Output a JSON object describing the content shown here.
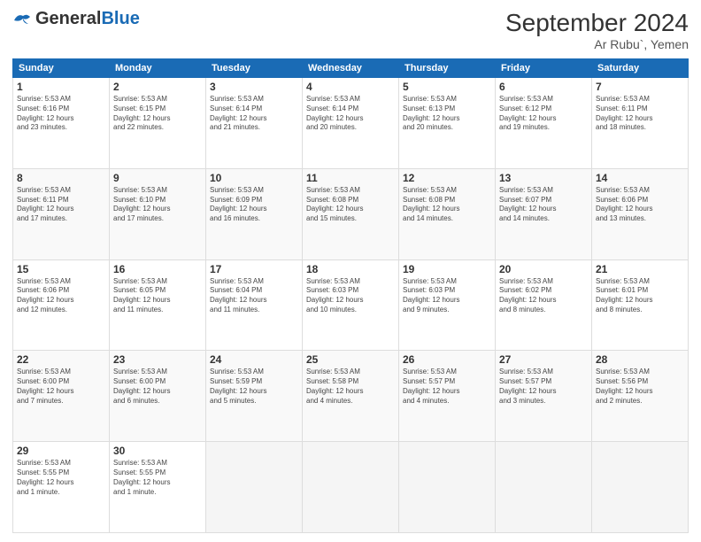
{
  "header": {
    "logo_general": "General",
    "logo_blue": "Blue",
    "logo_sub": "",
    "month_title": "September 2024",
    "location": "Ar Rubu`, Yemen"
  },
  "days_of_week": [
    "Sunday",
    "Monday",
    "Tuesday",
    "Wednesday",
    "Thursday",
    "Friday",
    "Saturday"
  ],
  "weeks": [
    [
      {
        "day": "1",
        "lines": [
          "Sunrise: 5:53 AM",
          "Sunset: 6:16 PM",
          "Daylight: 12 hours",
          "and 23 minutes."
        ]
      },
      {
        "day": "2",
        "lines": [
          "Sunrise: 5:53 AM",
          "Sunset: 6:15 PM",
          "Daylight: 12 hours",
          "and 22 minutes."
        ]
      },
      {
        "day": "3",
        "lines": [
          "Sunrise: 5:53 AM",
          "Sunset: 6:14 PM",
          "Daylight: 12 hours",
          "and 21 minutes."
        ]
      },
      {
        "day": "4",
        "lines": [
          "Sunrise: 5:53 AM",
          "Sunset: 6:14 PM",
          "Daylight: 12 hours",
          "and 20 minutes."
        ]
      },
      {
        "day": "5",
        "lines": [
          "Sunrise: 5:53 AM",
          "Sunset: 6:13 PM",
          "Daylight: 12 hours",
          "and 20 minutes."
        ]
      },
      {
        "day": "6",
        "lines": [
          "Sunrise: 5:53 AM",
          "Sunset: 6:12 PM",
          "Daylight: 12 hours",
          "and 19 minutes."
        ]
      },
      {
        "day": "7",
        "lines": [
          "Sunrise: 5:53 AM",
          "Sunset: 6:11 PM",
          "Daylight: 12 hours",
          "and 18 minutes."
        ]
      }
    ],
    [
      {
        "day": "8",
        "lines": [
          "Sunrise: 5:53 AM",
          "Sunset: 6:11 PM",
          "Daylight: 12 hours",
          "and 17 minutes."
        ]
      },
      {
        "day": "9",
        "lines": [
          "Sunrise: 5:53 AM",
          "Sunset: 6:10 PM",
          "Daylight: 12 hours",
          "and 17 minutes."
        ]
      },
      {
        "day": "10",
        "lines": [
          "Sunrise: 5:53 AM",
          "Sunset: 6:09 PM",
          "Daylight: 12 hours",
          "and 16 minutes."
        ]
      },
      {
        "day": "11",
        "lines": [
          "Sunrise: 5:53 AM",
          "Sunset: 6:08 PM",
          "Daylight: 12 hours",
          "and 15 minutes."
        ]
      },
      {
        "day": "12",
        "lines": [
          "Sunrise: 5:53 AM",
          "Sunset: 6:08 PM",
          "Daylight: 12 hours",
          "and 14 minutes."
        ]
      },
      {
        "day": "13",
        "lines": [
          "Sunrise: 5:53 AM",
          "Sunset: 6:07 PM",
          "Daylight: 12 hours",
          "and 14 minutes."
        ]
      },
      {
        "day": "14",
        "lines": [
          "Sunrise: 5:53 AM",
          "Sunset: 6:06 PM",
          "Daylight: 12 hours",
          "and 13 minutes."
        ]
      }
    ],
    [
      {
        "day": "15",
        "lines": [
          "Sunrise: 5:53 AM",
          "Sunset: 6:06 PM",
          "Daylight: 12 hours",
          "and 12 minutes."
        ]
      },
      {
        "day": "16",
        "lines": [
          "Sunrise: 5:53 AM",
          "Sunset: 6:05 PM",
          "Daylight: 12 hours",
          "and 11 minutes."
        ]
      },
      {
        "day": "17",
        "lines": [
          "Sunrise: 5:53 AM",
          "Sunset: 6:04 PM",
          "Daylight: 12 hours",
          "and 11 minutes."
        ]
      },
      {
        "day": "18",
        "lines": [
          "Sunrise: 5:53 AM",
          "Sunset: 6:03 PM",
          "Daylight: 12 hours",
          "and 10 minutes."
        ]
      },
      {
        "day": "19",
        "lines": [
          "Sunrise: 5:53 AM",
          "Sunset: 6:03 PM",
          "Daylight: 12 hours",
          "and 9 minutes."
        ]
      },
      {
        "day": "20",
        "lines": [
          "Sunrise: 5:53 AM",
          "Sunset: 6:02 PM",
          "Daylight: 12 hours",
          "and 8 minutes."
        ]
      },
      {
        "day": "21",
        "lines": [
          "Sunrise: 5:53 AM",
          "Sunset: 6:01 PM",
          "Daylight: 12 hours",
          "and 8 minutes."
        ]
      }
    ],
    [
      {
        "day": "22",
        "lines": [
          "Sunrise: 5:53 AM",
          "Sunset: 6:00 PM",
          "Daylight: 12 hours",
          "and 7 minutes."
        ]
      },
      {
        "day": "23",
        "lines": [
          "Sunrise: 5:53 AM",
          "Sunset: 6:00 PM",
          "Daylight: 12 hours",
          "and 6 minutes."
        ]
      },
      {
        "day": "24",
        "lines": [
          "Sunrise: 5:53 AM",
          "Sunset: 5:59 PM",
          "Daylight: 12 hours",
          "and 5 minutes."
        ]
      },
      {
        "day": "25",
        "lines": [
          "Sunrise: 5:53 AM",
          "Sunset: 5:58 PM",
          "Daylight: 12 hours",
          "and 4 minutes."
        ]
      },
      {
        "day": "26",
        "lines": [
          "Sunrise: 5:53 AM",
          "Sunset: 5:57 PM",
          "Daylight: 12 hours",
          "and 4 minutes."
        ]
      },
      {
        "day": "27",
        "lines": [
          "Sunrise: 5:53 AM",
          "Sunset: 5:57 PM",
          "Daylight: 12 hours",
          "and 3 minutes."
        ]
      },
      {
        "day": "28",
        "lines": [
          "Sunrise: 5:53 AM",
          "Sunset: 5:56 PM",
          "Daylight: 12 hours",
          "and 2 minutes."
        ]
      }
    ],
    [
      {
        "day": "29",
        "lines": [
          "Sunrise: 5:53 AM",
          "Sunset: 5:55 PM",
          "Daylight: 12 hours",
          "and 1 minute."
        ]
      },
      {
        "day": "30",
        "lines": [
          "Sunrise: 5:53 AM",
          "Sunset: 5:55 PM",
          "Daylight: 12 hours",
          "and 1 minute."
        ]
      },
      {
        "day": "",
        "lines": []
      },
      {
        "day": "",
        "lines": []
      },
      {
        "day": "",
        "lines": []
      },
      {
        "day": "",
        "lines": []
      },
      {
        "day": "",
        "lines": []
      }
    ]
  ]
}
